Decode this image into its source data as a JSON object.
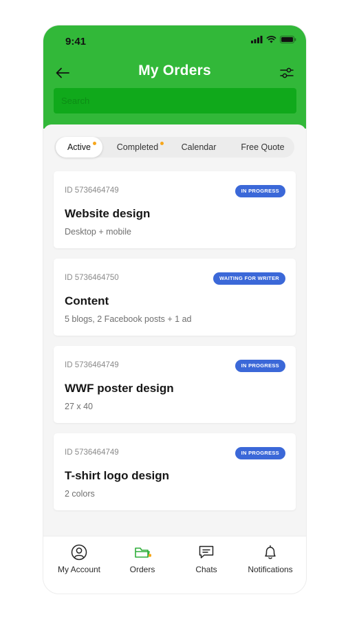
{
  "status": {
    "time": "9:41"
  },
  "header": {
    "title": "My Orders"
  },
  "search": {
    "placeholder": "Search"
  },
  "tabs": [
    {
      "label": "Active",
      "active": true,
      "dot": true
    },
    {
      "label": "Completed",
      "active": false,
      "dot": true
    },
    {
      "label": "Calendar",
      "active": false,
      "dot": false
    },
    {
      "label": "Free Quote",
      "active": false,
      "dot": false
    }
  ],
  "orders": [
    {
      "id": "ID 5736464749",
      "status": "IN PROGRESS",
      "title": "Website design",
      "detail": "Desktop + mobile"
    },
    {
      "id": "ID 5736464750",
      "status": "WAITING FOR WRITER",
      "title": "Content",
      "detail": "5 blogs, 2 Facebook posts + 1 ad"
    },
    {
      "id": "ID 5736464749",
      "status": "IN PROGRESS",
      "title": "WWF poster design",
      "detail": "27 x 40"
    },
    {
      "id": "ID 5736464749",
      "status": "IN PROGRESS",
      "title": "T-shirt logo design",
      "detail": "2 colors"
    }
  ],
  "bottom_nav": [
    {
      "label": "My Account",
      "icon": "account-icon",
      "active": false
    },
    {
      "label": "Orders",
      "icon": "folder-icon",
      "active": true,
      "dot": true
    },
    {
      "label": "Chats",
      "icon": "chat-icon",
      "active": false
    },
    {
      "label": "Notifications",
      "icon": "bell-icon",
      "active": false
    }
  ],
  "colors": {
    "brand_green": "#32b839",
    "search_green": "#10a91b",
    "badge_blue": "#3b68d8",
    "dot_orange": "#f6a61b",
    "active_icon_green": "#2fae3a"
  }
}
